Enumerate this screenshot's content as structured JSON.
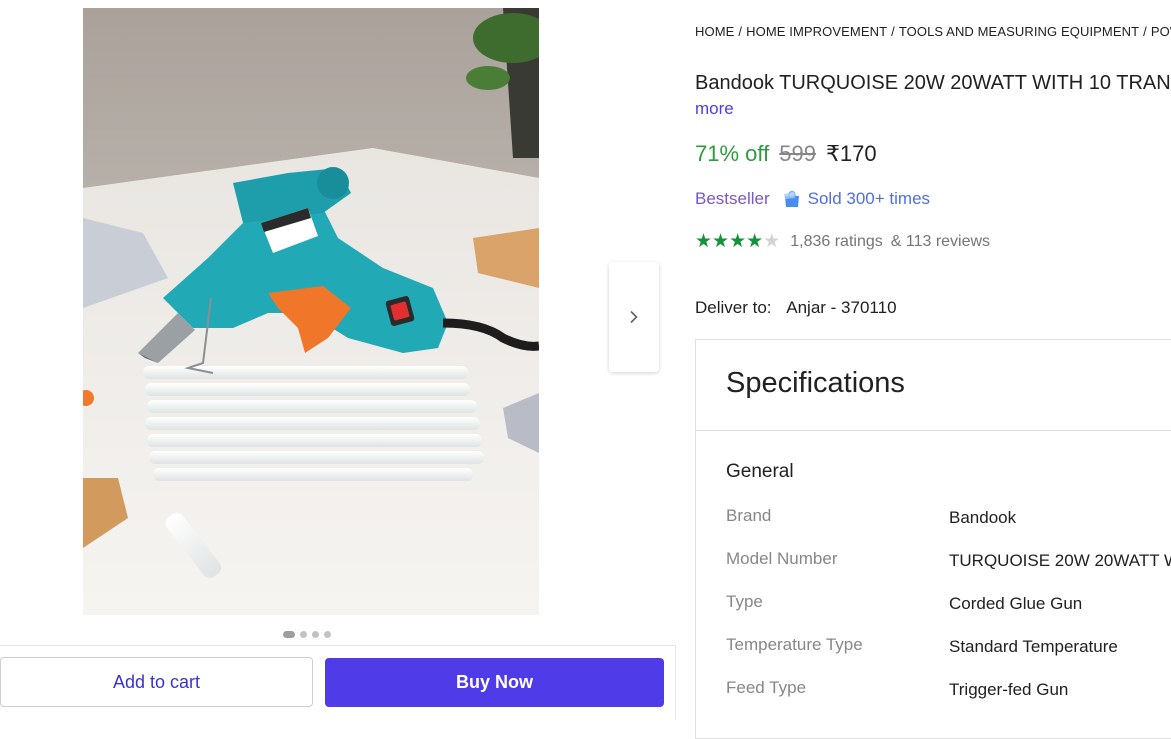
{
  "breadcrumb": [
    "HOME",
    "HOME IMPROVEMENT",
    "TOOLS AND MEASURING EQUIPMENT",
    "POWER"
  ],
  "product": {
    "title": "Bandook TURQUOISE 20W 20WATT WITH 10 TRAN",
    "more_label": "more",
    "discount": "71% off",
    "mrp": "599",
    "price": "₹170",
    "bestseller_label": "Bestseller",
    "sold_label": "Sold 300+ times",
    "rating_value": 4,
    "rating_max": 5,
    "ratings_count": "1,836 ratings",
    "reviews_count": "& 113 reviews"
  },
  "delivery": {
    "label": "Deliver to:",
    "location": "Anjar - 370110"
  },
  "gallery": {
    "image_count": 4,
    "active_index": 0
  },
  "actions": {
    "add_to_cart": "Add to cart",
    "buy_now": "Buy Now"
  },
  "specifications": {
    "title": "Specifications",
    "section": "General",
    "rows": [
      {
        "key": "Brand",
        "value": "Bandook"
      },
      {
        "key": "Model Number",
        "value": "TURQUOISE 20W 20WATT W"
      },
      {
        "key": "Type",
        "value": "Corded Glue Gun"
      },
      {
        "key": "Temperature Type",
        "value": "Standard Temperature"
      },
      {
        "key": "Feed Type",
        "value": "Trigger-fed Gun"
      }
    ]
  },
  "icons": {
    "next": "chevron-right-icon",
    "sold": "shopping-bag-icon",
    "star": "star-icon"
  },
  "colors": {
    "accent": "#4f3ce8",
    "discount": "#2e9b3e",
    "star": "#14923c",
    "bestseller": "#7a56c8",
    "sold": "#4f6fe0"
  }
}
